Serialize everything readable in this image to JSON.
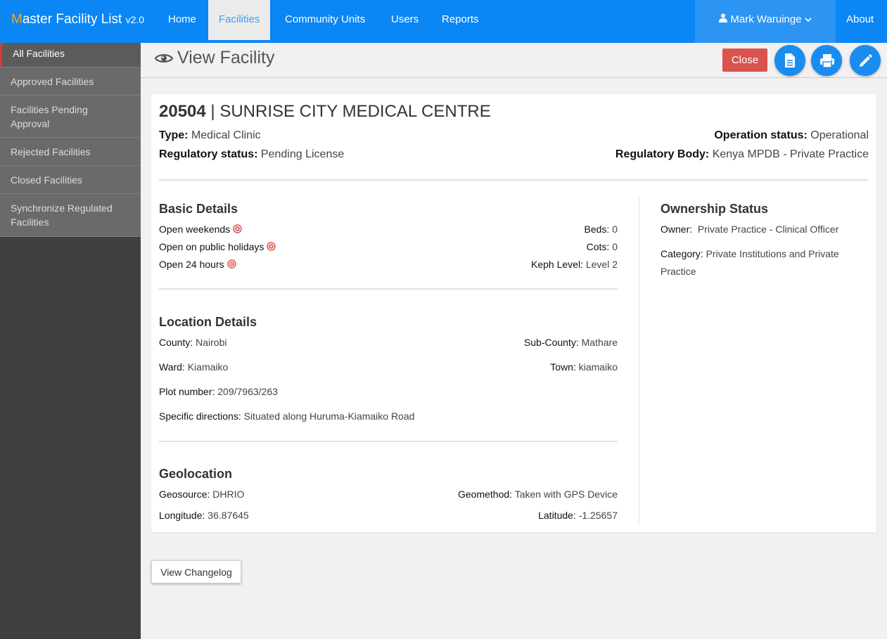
{
  "brand": {
    "first_letter": "M",
    "rest": "aster Facility List",
    "version": "v2.0"
  },
  "nav": {
    "home": "Home",
    "facilities": "Facilities",
    "community_units": "Community Units",
    "users": "Users",
    "reports": "Reports",
    "user_name": "Mark Waruinge",
    "about": "About"
  },
  "sidebar": {
    "items": [
      {
        "label": "All Facilities"
      },
      {
        "label": "Approved Facilities"
      },
      {
        "label": "Facilities Pending Approval"
      },
      {
        "label": "Rejected Facilities"
      },
      {
        "label": "Closed Facilities"
      },
      {
        "label": "Synchronize Regulated Facilities"
      }
    ]
  },
  "header": {
    "title": "View Facility",
    "close_label": "Close",
    "icons": [
      "eye-icon",
      "document-icon",
      "print-icon",
      "edit-pencil-icon"
    ]
  },
  "facility": {
    "code": "20504",
    "separator": "|",
    "name": "SUNRISE CITY MEDICAL CENTRE",
    "type_label": "Type:",
    "type": "Medical Clinic",
    "regulatory_status_label": "Regulatory status:",
    "regulatory_status": "Pending License",
    "operation_status_label": "Operation status:",
    "operation_status": "Operational",
    "regulatory_body_label": "Regulatory Body:",
    "regulatory_body": "Kenya MPDB - Private Practice"
  },
  "basic_details": {
    "title": "Basic Details",
    "open_weekends": "Open weekends",
    "open_public_holidays": "Open on public holidays",
    "open_24_hours": "Open 24 hours",
    "beds_label": "Beds:",
    "beds": "0",
    "cots_label": "Cots:",
    "cots": "0",
    "keph_label": "Keph Level:",
    "keph": "Level 2",
    "status_icon": "x-circle-icon",
    "status_color": "#d9534f"
  },
  "location_details": {
    "title": "Location Details",
    "county_label": "County:",
    "county": "Nairobi",
    "subcounty_label": "Sub-County:",
    "subcounty": "Mathare",
    "ward_label": "Ward:",
    "ward": "Kiamaiko",
    "town_label": "Town:",
    "town": "kiamaiko",
    "plot_label": "Plot number:",
    "plot": "209/7963/263",
    "directions_label": "Specific directions:",
    "directions": "Situated along Huruma-Kiamaiko Road"
  },
  "geolocation": {
    "title": "Geolocation",
    "geosource_label": "Geosource:",
    "geosource": "DHRIO",
    "geomethod_label": "Geomethod:",
    "geomethod": "Taken with GPS Device",
    "longitude_label": "Longitude:",
    "longitude": "36.87645",
    "latitude_label": "Latitude:",
    "latitude": "-1.25657"
  },
  "ownership": {
    "title": "Ownership Status",
    "owner_label": "Owner:",
    "owner": "Private Practice - Clinical Officer",
    "category_label": "Category:",
    "category_line1": "Private Institutions and Private",
    "category_line2": "Practice"
  },
  "changelog_label": "View Changelog",
  "colors": {
    "nav": "#0a86f5",
    "sidebar": "#3f3f3f",
    "close": "#d9534f",
    "action": "#1a8cf0"
  }
}
